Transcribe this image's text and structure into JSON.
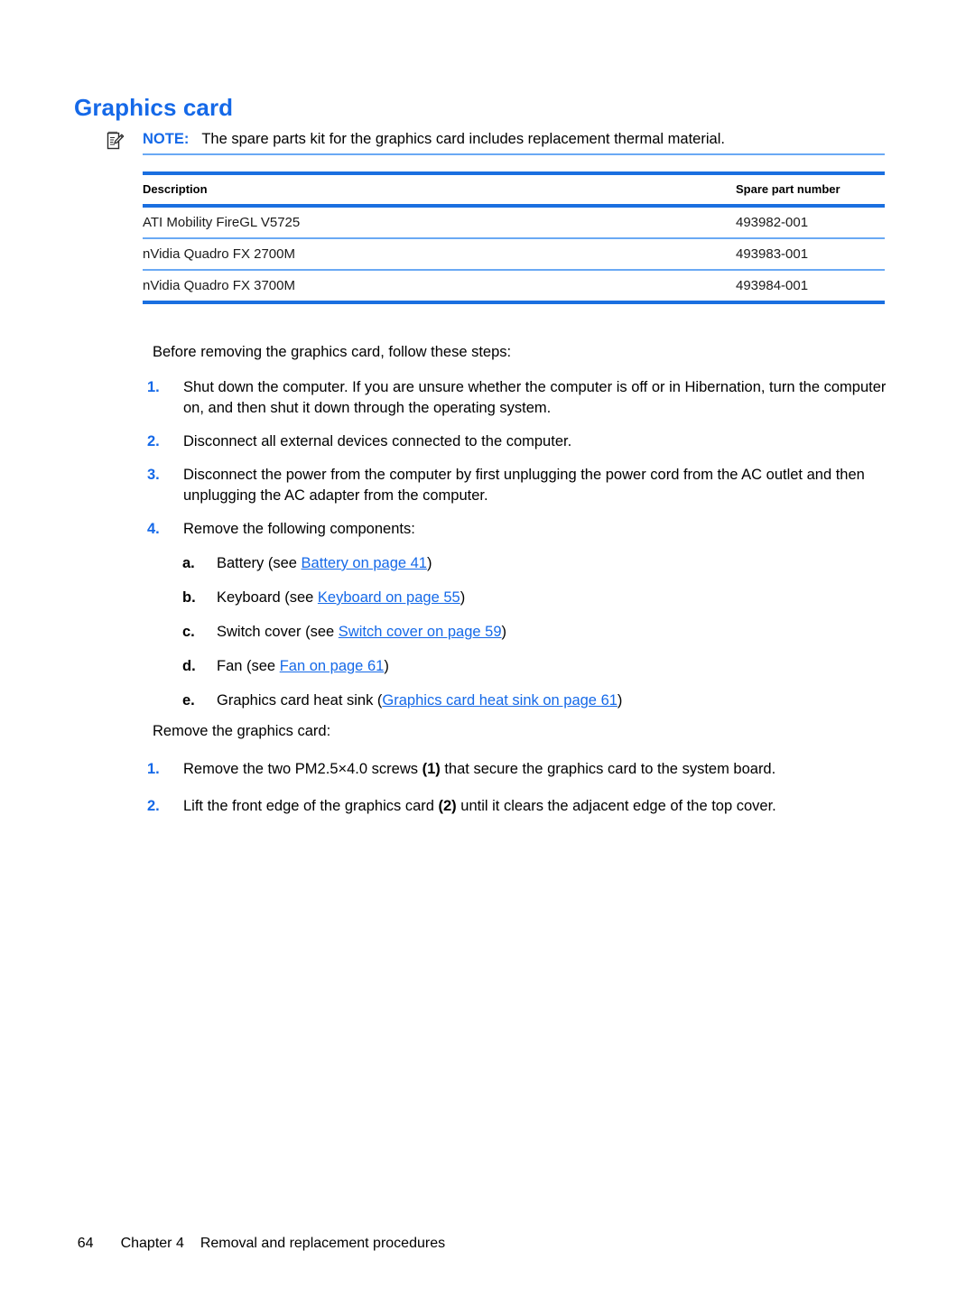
{
  "heading": "Graphics card",
  "note": {
    "icon": "note-pencil-icon",
    "label": "NOTE:",
    "text": "The spare parts kit for the graphics card includes replacement thermal material."
  },
  "colors": {
    "heading_blue": "#1569e8",
    "rule_blue": "#1a6fe0",
    "rule_light_blue": "#6aa9f4",
    "link_blue": "#1569e8",
    "body_black": "#000000"
  },
  "table": {
    "columns": [
      "Description",
      "Spare part number"
    ],
    "rows": [
      {
        "description": "ATI Mobility FireGL V5725",
        "spare_part_number": "493982-001"
      },
      {
        "description": "nVidia Quadro FX 2700M",
        "spare_part_number": "493983-001"
      },
      {
        "description": "nVidia Quadro FX 3700M",
        "spare_part_number": "493984-001"
      }
    ]
  },
  "intro_before": "Before removing the graphics card, follow these steps:",
  "steps_before": [
    {
      "marker": "1.",
      "text": "Shut down the computer. If you are unsure whether the computer is off or in Hibernation, turn the computer on, and then shut it down through the operating system."
    },
    {
      "marker": "2.",
      "text": "Disconnect all external devices connected to the computer."
    },
    {
      "marker": "3.",
      "text": "Disconnect the power from the computer by first unplugging the power cord from the AC outlet and then unplugging the AC adapter from the computer."
    },
    {
      "marker": "4.",
      "text": "Remove the following components:"
    }
  ],
  "components": [
    {
      "marker": "a.",
      "prefix": "Battery (see ",
      "link": "Battery on page 41",
      "suffix": ")"
    },
    {
      "marker": "b.",
      "prefix": "Keyboard (see ",
      "link": "Keyboard on page 55",
      "suffix": ")"
    },
    {
      "marker": "c.",
      "prefix": "Switch cover (see ",
      "link": "Switch cover on page 59",
      "suffix": ")"
    },
    {
      "marker": "d.",
      "prefix": "Fan (see ",
      "link": "Fan on page 61",
      "suffix": ")"
    },
    {
      "marker": "e.",
      "prefix": "Graphics card heat sink (",
      "link": "Graphics card heat sink on page 61",
      "suffix": ")"
    }
  ],
  "intro_remove": "Remove the graphics card:",
  "steps_remove": [
    {
      "marker": "1.",
      "pre": "Remove the two PM2.5×4.0 screws ",
      "callout": "(1)",
      "post": " that secure the graphics card to the system board."
    },
    {
      "marker": "2.",
      "pre": "Lift the front edge of the graphics card ",
      "callout": "(2)",
      "post": " until it clears the adjacent edge of the top cover."
    }
  ],
  "footer": {
    "page_number": "64",
    "chapter": "Chapter 4",
    "title": "Removal and replacement procedures"
  }
}
